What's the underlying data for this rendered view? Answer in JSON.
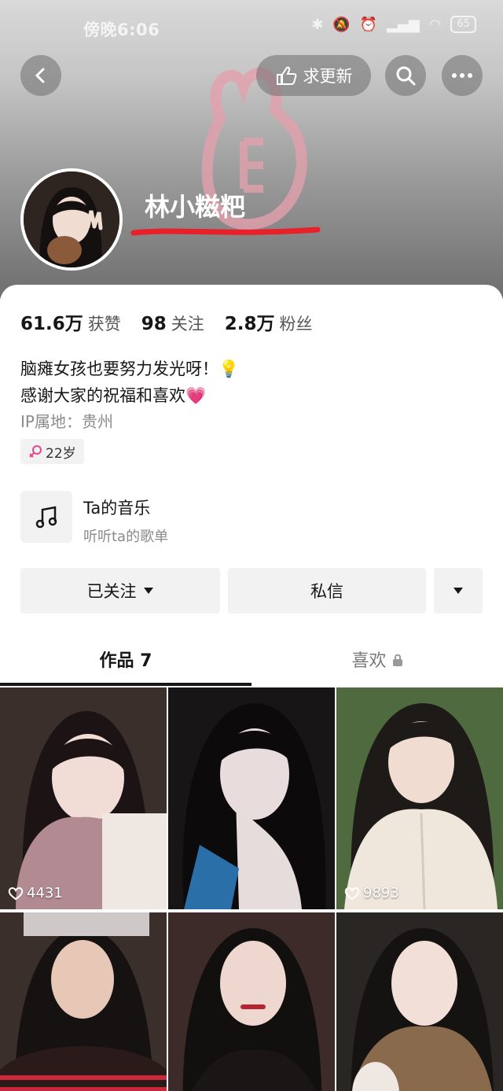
{
  "status_bar": {
    "time": "傍晚6:06",
    "battery": "65"
  },
  "header": {
    "request_update_label": "求更新",
    "username": "林小糍粑"
  },
  "stats": [
    {
      "value": "61.6万",
      "label": "获赞"
    },
    {
      "value": "98",
      "label": "关注"
    },
    {
      "value": "2.8万",
      "label": "粉丝"
    }
  ],
  "bio": {
    "line1": "脑瘫女孩也要努力发光呀！💡",
    "line2": "感谢大家的祝福和喜欢💗"
  },
  "ip_location": "IP属地：贵州",
  "age_tag": "22岁",
  "music": {
    "title": "Ta的音乐",
    "subtitle": "听听ta的歌单"
  },
  "actions": {
    "follow_label": "已关注",
    "message_label": "私信"
  },
  "tabs": [
    {
      "label": "作品 7"
    },
    {
      "label": "喜欢"
    }
  ],
  "videos": [
    {
      "likes": "4431"
    },
    {
      "likes": ""
    },
    {
      "likes": "9893"
    },
    {
      "likes": ""
    },
    {
      "likes": ""
    },
    {
      "likes": ""
    }
  ],
  "colors": {
    "accent_pink": "#ff2d6f",
    "age_icon_pink": "#e8468a"
  }
}
